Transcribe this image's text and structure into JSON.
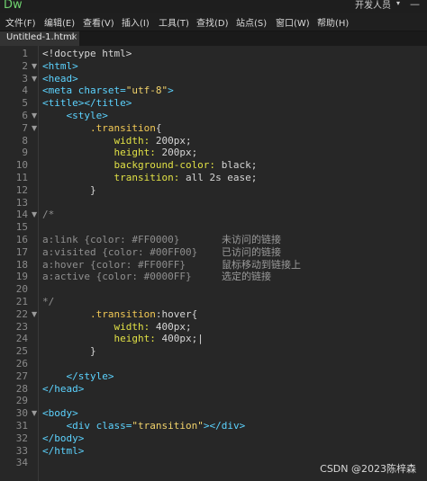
{
  "app": {
    "logo": "Dw",
    "workspace": "开发人员",
    "workspace_caret": "▾",
    "minimize": "—"
  },
  "menu": [
    "文件(F)",
    "编辑(E)",
    "查看(V)",
    "插入(I)",
    "工具(T)",
    "查找(D)",
    "站点(S)",
    "窗口(W)",
    "帮助(H)"
  ],
  "tab": {
    "title": "Untitled-1.html",
    "close": "×"
  },
  "colors": {
    "background": "#272727",
    "tag": "#5cd3ff",
    "string": "#f2d36b",
    "property": "#e0e045",
    "selector": "#f2c955",
    "comment": "#8f8f8f",
    "text": "#d6d6d6"
  },
  "lines": [
    {
      "n": "1",
      "fold": "",
      "segs": [
        {
          "t": "<!doctype html>",
          "c": "#d6d6d6"
        }
      ]
    },
    {
      "n": "2",
      "fold": "▼",
      "segs": [
        {
          "t": "<html>",
          "c": "#5cd3ff"
        }
      ]
    },
    {
      "n": "3",
      "fold": "▼",
      "segs": [
        {
          "t": "<head>",
          "c": "#5cd3ff"
        }
      ]
    },
    {
      "n": "4",
      "fold": "",
      "segs": [
        {
          "t": "<meta charset=",
          "c": "#5cd3ff"
        },
        {
          "t": "\"utf-8\"",
          "c": "#f2d36b"
        },
        {
          "t": ">",
          "c": "#5cd3ff"
        }
      ]
    },
    {
      "n": "5",
      "fold": "",
      "segs": [
        {
          "t": "<title></title>",
          "c": "#5cd3ff"
        }
      ]
    },
    {
      "n": "6",
      "fold": "▼",
      "segs": [
        {
          "t": "    <style>",
          "c": "#5cd3ff"
        }
      ]
    },
    {
      "n": "7",
      "fold": "▼",
      "segs": [
        {
          "t": "        .transition",
          "c": "#f2c955"
        },
        {
          "t": "{",
          "c": "#d6d6d6"
        }
      ]
    },
    {
      "n": "8",
      "fold": "",
      "segs": [
        {
          "t": "            width: ",
          "c": "#e0e045"
        },
        {
          "t": "200px;",
          "c": "#d6d6d6"
        }
      ]
    },
    {
      "n": "9",
      "fold": "",
      "segs": [
        {
          "t": "            height: ",
          "c": "#e0e045"
        },
        {
          "t": "200px;",
          "c": "#d6d6d6"
        }
      ]
    },
    {
      "n": "10",
      "fold": "",
      "segs": [
        {
          "t": "            background-color: ",
          "c": "#e0e045"
        },
        {
          "t": "black;",
          "c": "#d6d6d6"
        }
      ]
    },
    {
      "n": "11",
      "fold": "",
      "segs": [
        {
          "t": "            transition: ",
          "c": "#e0e045"
        },
        {
          "t": "all 2s ease;",
          "c": "#d6d6d6"
        }
      ]
    },
    {
      "n": "12",
      "fold": "",
      "segs": [
        {
          "t": "        }",
          "c": "#d6d6d6"
        }
      ]
    },
    {
      "n": "13",
      "fold": "",
      "segs": []
    },
    {
      "n": "14",
      "fold": "▼",
      "segs": [
        {
          "t": "/*",
          "c": "#8f8f8f"
        }
      ]
    },
    {
      "n": "15",
      "fold": "",
      "segs": []
    },
    {
      "n": "16",
      "fold": "",
      "segs": [
        {
          "t": "a:link {color: #FF0000}",
          "c": "#8f8f8f"
        }
      ],
      "note": "未访问的链接"
    },
    {
      "n": "17",
      "fold": "",
      "segs": [
        {
          "t": "a:visited {color: #00FF00}",
          "c": "#8f8f8f"
        }
      ],
      "note": "已访问的链接"
    },
    {
      "n": "18",
      "fold": "",
      "segs": [
        {
          "t": "a:hover {color: #FF00FF}",
          "c": "#8f8f8f"
        }
      ],
      "note": "鼠标移动到链接上"
    },
    {
      "n": "19",
      "fold": "",
      "segs": [
        {
          "t": "a:active {color: #0000FF}",
          "c": "#8f8f8f"
        }
      ],
      "note": "选定的链接"
    },
    {
      "n": "20",
      "fold": "",
      "segs": []
    },
    {
      "n": "21",
      "fold": "",
      "segs": [
        {
          "t": "*/",
          "c": "#8f8f8f"
        }
      ]
    },
    {
      "n": "22",
      "fold": "▼",
      "segs": [
        {
          "t": "        .transition",
          "c": "#f2c955"
        },
        {
          "t": ":hover{",
          "c": "#d6d6d6"
        }
      ]
    },
    {
      "n": "23",
      "fold": "",
      "segs": [
        {
          "t": "            width: ",
          "c": "#e0e045"
        },
        {
          "t": "400px;",
          "c": "#d6d6d6"
        }
      ]
    },
    {
      "n": "24",
      "fold": "",
      "segs": [
        {
          "t": "            height: ",
          "c": "#e0e045"
        },
        {
          "t": "400px;|",
          "c": "#d6d6d6"
        }
      ]
    },
    {
      "n": "25",
      "fold": "",
      "segs": [
        {
          "t": "        }",
          "c": "#d6d6d6"
        }
      ]
    },
    {
      "n": "26",
      "fold": "",
      "segs": []
    },
    {
      "n": "27",
      "fold": "",
      "segs": [
        {
          "t": "    </style>",
          "c": "#5cd3ff"
        }
      ]
    },
    {
      "n": "28",
      "fold": "",
      "segs": [
        {
          "t": "</head>",
          "c": "#5cd3ff"
        }
      ]
    },
    {
      "n": "29",
      "fold": "",
      "segs": []
    },
    {
      "n": "30",
      "fold": "▼",
      "segs": [
        {
          "t": "<body>",
          "c": "#5cd3ff"
        }
      ]
    },
    {
      "n": "31",
      "fold": "",
      "segs": [
        {
          "t": "    <div class=",
          "c": "#5cd3ff"
        },
        {
          "t": "\"transition\"",
          "c": "#f2d36b"
        },
        {
          "t": "></div>",
          "c": "#5cd3ff"
        }
      ]
    },
    {
      "n": "32",
      "fold": "",
      "segs": [
        {
          "t": "</body>",
          "c": "#5cd3ff"
        }
      ]
    },
    {
      "n": "33",
      "fold": "",
      "segs": [
        {
          "t": "</html>",
          "c": "#5cd3ff"
        }
      ]
    },
    {
      "n": "34",
      "fold": "",
      "segs": []
    }
  ],
  "watermark": "CSDN @2023陈梓森"
}
